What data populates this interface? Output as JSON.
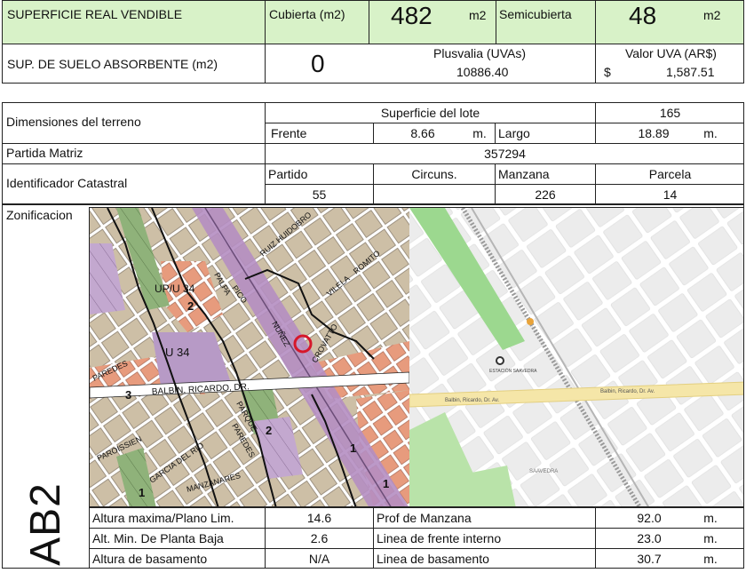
{
  "header": {
    "superficie_label": "SUPERFICIE REAL VENDIBLE",
    "cubierta_label": "Cubierta (m2)",
    "cubierta_value": "482",
    "cubierta_unit": "m2",
    "semicubierta_label": "Semicubierta",
    "semicubierta_value": "48",
    "semicubierta_unit": "m2",
    "suelo_label": "SUP. DE SUELO ABSORBENTE (m2)",
    "suelo_value": "0",
    "plusvalia_label": "Plusvalia (UVAs)",
    "plusvalia_value": "10886.40",
    "uva_label": "Valor UVA (AR$)",
    "uva_currency": "$",
    "uva_value": "1,587.51"
  },
  "terreno": {
    "dimensiones_label": "Dimensiones del terreno",
    "superficie_lote_label": "Superficie del lote",
    "superficie_lote_value": "165",
    "frente_label": "Frente",
    "frente_value": "8.66",
    "frente_unit": "m.",
    "largo_label": "Largo",
    "largo_value": "18.89",
    "largo_unit": "m.",
    "partida_label": "Partida Matriz",
    "partida_value": "357294",
    "catastral_label": "Identificador Catastral",
    "partido_label": "Partido",
    "partido_value": "55",
    "circuns_label": "Circuns.",
    "circuns_value": "",
    "manzana_label": "Manzana",
    "manzana_value": "226",
    "parcela_label": "Parcela",
    "parcela_value": "14"
  },
  "zonificacion": {
    "label": "Zonificacion",
    "zone_code": "AB2"
  },
  "zoning_map": {
    "labels": [
      "UP/U 34",
      "U 34",
      "BALBIN, RICARDO, DR.",
      "PAREDES",
      "PAROISSIEN",
      "GARCIA DEL RIO",
      "MANZANARES",
      "PAREDES",
      "PICO",
      "VILELA",
      "NUÑEZ",
      "RUIZ HUIDOBRO",
      "ROMITO",
      "CROVATTO",
      "PALPA",
      "PARQUE",
      "3",
      "2",
      "2",
      "1",
      "1",
      "1"
    ]
  },
  "street_map": {
    "labels": [
      "Balbin, Ricardo, Dr. Av.",
      "Balbin, Ricardo, Dr. Av.",
      "SAAVEDRA",
      "ESTACIÓN SAAVEDRA"
    ],
    "colors": {
      "park": "#9cd88f",
      "road": "#f5e6a8",
      "block": "#ececec",
      "marker": "#e8a33a"
    }
  },
  "parametros": [
    {
      "label": "Altura maxima/Plano Lim.",
      "value": "14.6",
      "label2": "Prof de Manzana",
      "value2": "92.0",
      "unit2": "m."
    },
    {
      "label": "Alt. Min. De Planta Baja",
      "value": "2.6",
      "label2": "Linea de frente interno",
      "value2": "23.0",
      "unit2": "m."
    },
    {
      "label": "Altura de basamento",
      "value": "N/A",
      "label2": "Linea de basamento",
      "value2": "30.7",
      "unit2": "m."
    }
  ]
}
